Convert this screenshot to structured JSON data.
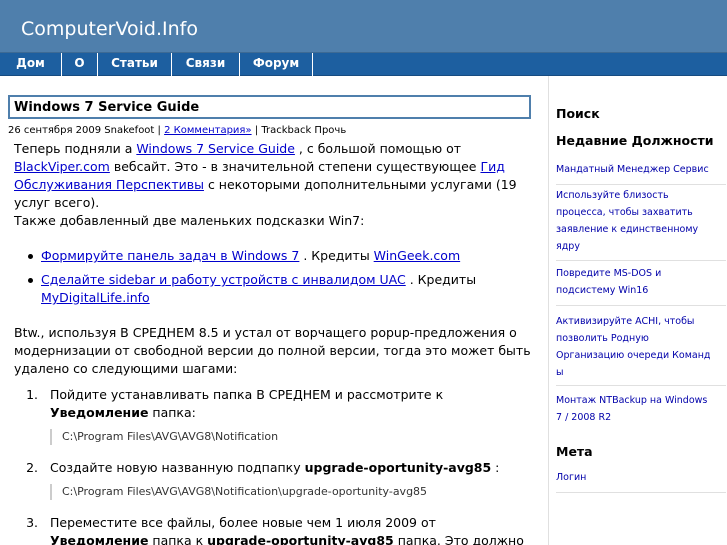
{
  "site": {
    "title": "ComputerVoid.Info"
  },
  "nav": {
    "items": [
      "Дом",
      "О",
      "Статьи",
      "Связи",
      "Форум"
    ]
  },
  "post": {
    "title": "Windows 7 Service Guide",
    "meta_date": "26 сентября 2009 Snakefoot |",
    "meta_comments": "2 Комментария»",
    "meta_trackback": "| Trackback Прочь",
    "p1": {
      "t1": "Теперь подняли а ",
      "link1": "Windows 7 Service Guide",
      "t2": " , с большой помощью от ",
      "link2": "BlackViper.com",
      "t3": " вебсайт. Это - в значительной степени существующее ",
      "link3": "Гид Обслуживания Перспективы",
      "t4": " с некоторыми дополнительными услугами (19 услуг всего)."
    },
    "p2": "Также добавленный две маленьких подсказки Win7:",
    "bullets": [
      {
        "link": "Формируйте панель задач в Windows 7",
        "mid": " . Кредиты ",
        "credit": "WinGeek.com"
      },
      {
        "link": "Сделайте sidebar и работу устройств с инвалидом UAC",
        "mid": " . Кредиты ",
        "credit": "MyDigitalLife.info"
      }
    ],
    "p3": "Btw., используя В СРЕДНЕМ 8.5 и устал от ворчащего popup-предложения о модернизации от свободной версии до полной версии, тогда это может быть удалено со следующими шагами:",
    "steps": [
      {
        "num": "1.",
        "t1": "Пойдите устанавливать папка В СРЕДНЕМ и рассмотрите к ",
        "b1": "Уведомление",
        "t2": " папка:",
        "code": "C:\\Program Files\\AVG\\AVG8\\Notification"
      },
      {
        "num": "2.",
        "t1": "Создайте новую названную подпапку ",
        "b1": "upgrade-oportunity-avg85",
        "t2": " :",
        "code": "C:\\Program Files\\AVG\\AVG8\\Notification\\upgrade-oportunity-avg85"
      },
      {
        "num": "3.",
        "t1": "Переместите все файлы, более новые чем 1 июля 2009 от ",
        "b1": "Уведомление",
        "t2": " папка к ",
        "b2": "upgrade-oportunity-avg85",
        "t3": " папка. Это должно включать файлы как:"
      }
    ]
  },
  "sidebar": {
    "search_heading": "Поиск",
    "recent_heading": "Недавние Должности",
    "recent": [
      [
        "Мандатный Менеджер Сервис"
      ],
      [
        "Используйте близость",
        "процесса, чтобы захватить",
        "заявление к единственному",
        "ядру"
      ],
      [
        "Повредите MS-DOS и",
        "подсистему Win16"
      ],
      [
        "Активизируйте ACHI, чтобы",
        "позволить Родную",
        "Организацию очереди Команд",
        "ы"
      ],
      [
        "Монтаж NTBackup на Windows",
        "7 / 2008 R2"
      ]
    ],
    "meta_heading": "Мета",
    "meta_link": "Логин"
  }
}
